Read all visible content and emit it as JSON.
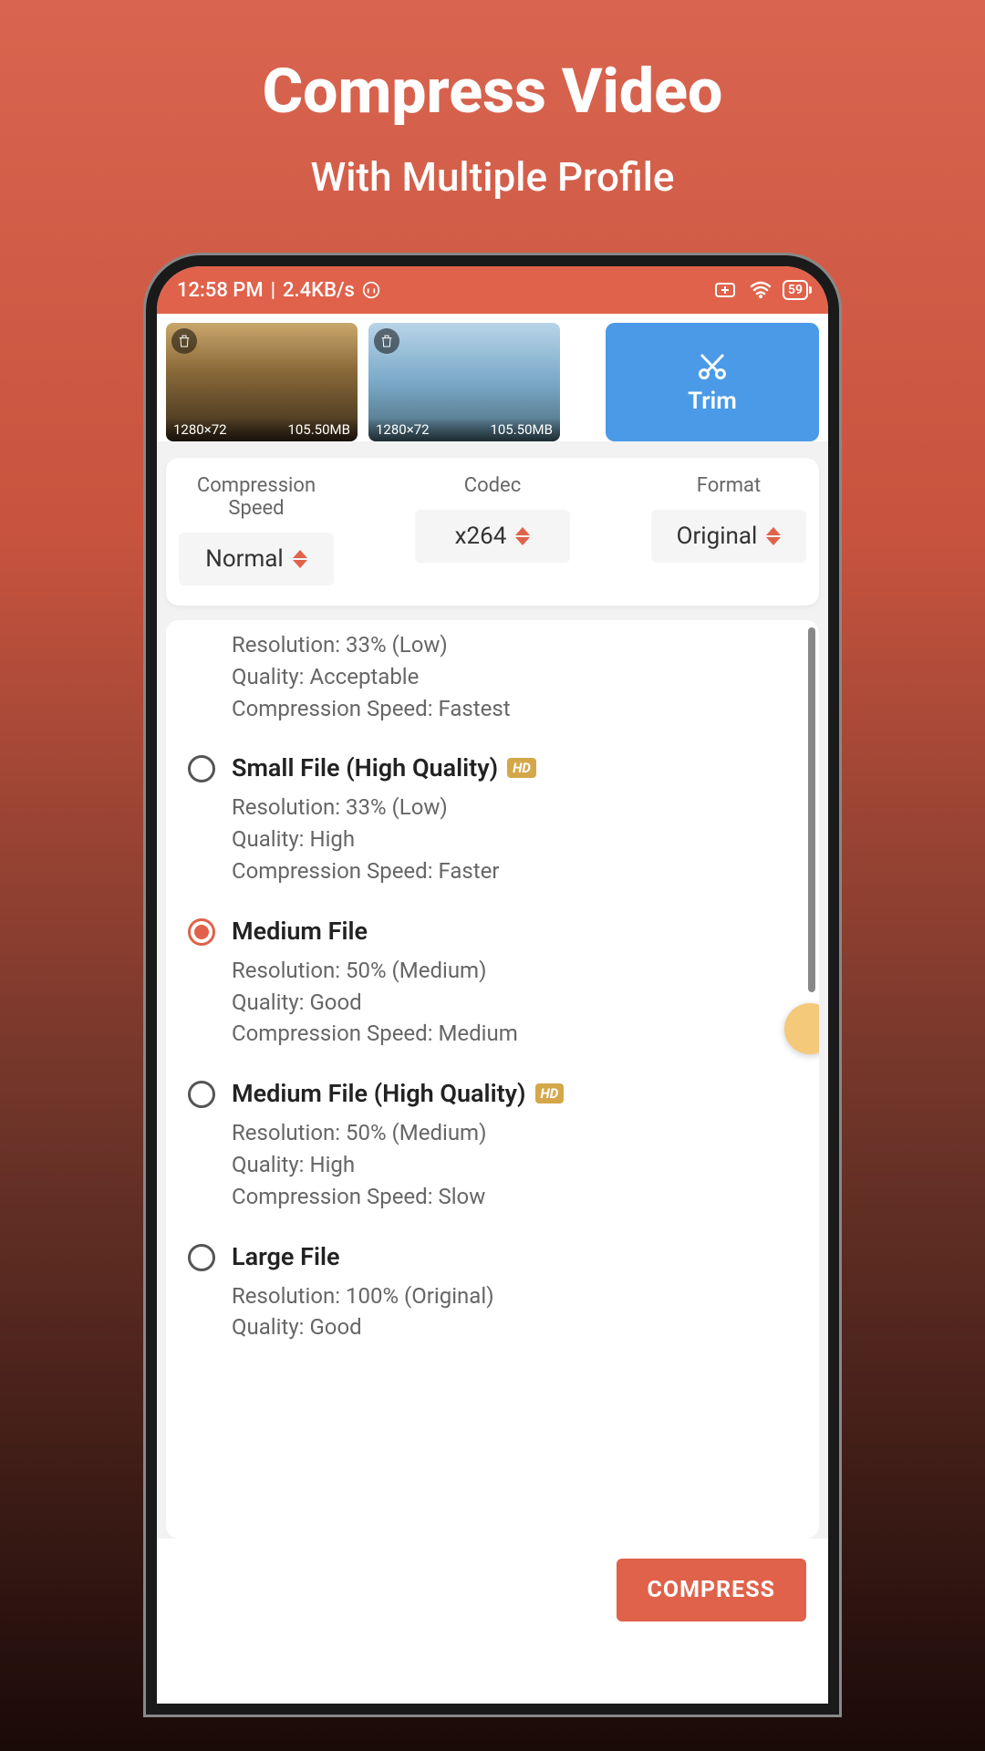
{
  "promo": {
    "title": "Compress Video",
    "subtitle": "With Multiple Profile"
  },
  "statusBar": {
    "time": "12:58 PM",
    "speed": "2.4KB/s",
    "battery": "59"
  },
  "thumbnails": [
    {
      "resolution": "1280×72",
      "size": "105.50MB"
    },
    {
      "resolution": "1280×72",
      "size": "105.50MB"
    }
  ],
  "trimLabel": "Trim",
  "settings": {
    "speed": {
      "label": "Compression Speed",
      "value": "Normal"
    },
    "codec": {
      "label": "Codec",
      "value": "x264"
    },
    "format": {
      "label": "Format",
      "value": "Original"
    }
  },
  "profiles": [
    {
      "title": "",
      "hd": false,
      "selected": false,
      "partial": true,
      "resolution": "Resolution: 33% (Low)",
      "quality": "Quality: Acceptable",
      "speed": "Compression Speed: Fastest"
    },
    {
      "title": "Small File (High Quality)",
      "hd": true,
      "selected": false,
      "resolution": "Resolution: 33% (Low)",
      "quality": "Quality: High",
      "speed": "Compression Speed: Faster"
    },
    {
      "title": "Medium File",
      "hd": false,
      "selected": true,
      "resolution": "Resolution: 50% (Medium)",
      "quality": "Quality: Good",
      "speed": "Compression Speed: Medium"
    },
    {
      "title": "Medium File (High Quality)",
      "hd": true,
      "selected": false,
      "resolution": "Resolution: 50% (Medium)",
      "quality": "Quality: High",
      "speed": "Compression Speed: Slow"
    },
    {
      "title": "Large File",
      "hd": false,
      "selected": false,
      "partialBottom": true,
      "resolution": "Resolution: 100% (Original)",
      "quality": "Quality: Good",
      "speed": ""
    }
  ],
  "hdBadge": "HD",
  "compressLabel": "COMPRESS"
}
